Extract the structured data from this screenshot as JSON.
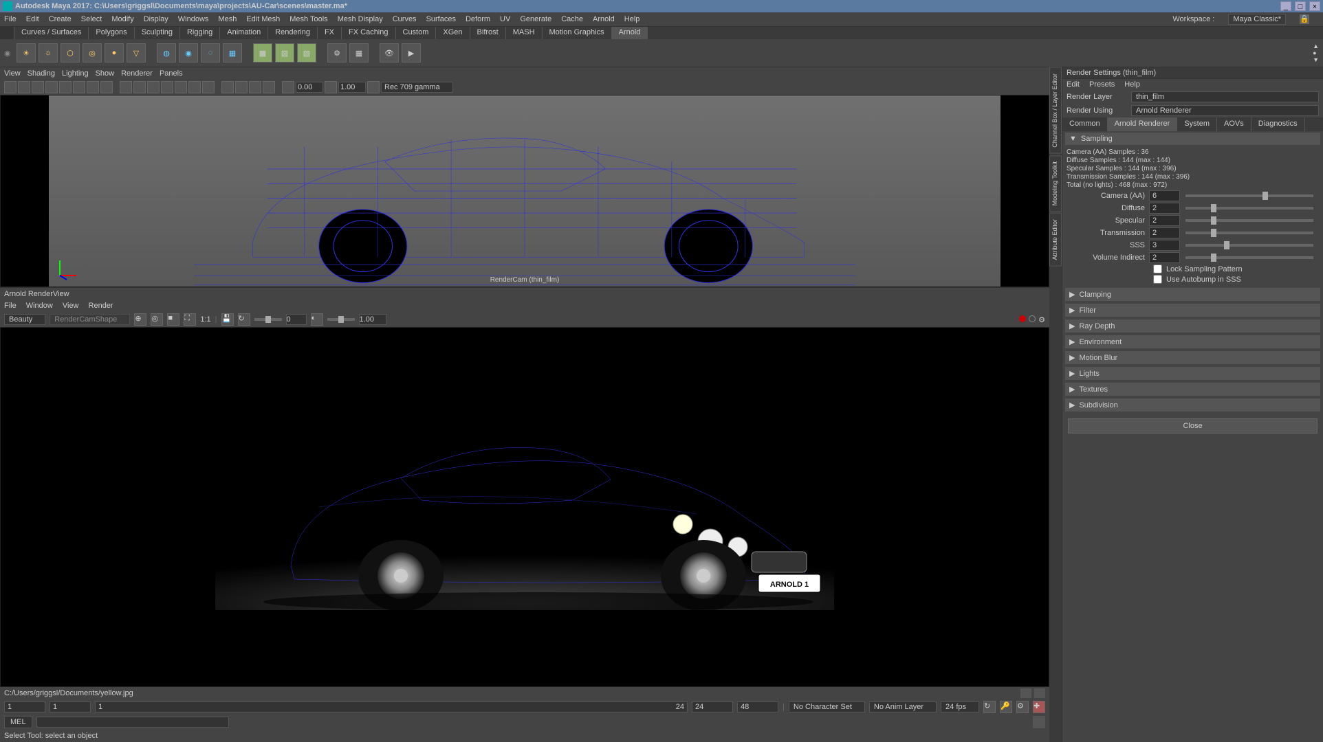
{
  "title": "Autodesk Maya 2017: C:\\Users\\griggsl\\Documents\\maya\\projects\\AU-Car\\scenes\\master.ma*",
  "menus": [
    "File",
    "Edit",
    "Create",
    "Select",
    "Modify",
    "Display",
    "Windows",
    "Mesh",
    "Edit Mesh",
    "Mesh Tools",
    "Mesh Display",
    "Curves",
    "Surfaces",
    "Deform",
    "UV",
    "Generate",
    "Cache",
    "Arnold",
    "Help"
  ],
  "workspace": {
    "label": "Workspace :",
    "value": "Maya Classic*"
  },
  "shelf_tabs": [
    "Curves / Surfaces",
    "Polygons",
    "Sculpting",
    "Rigging",
    "Animation",
    "Rendering",
    "FX",
    "FX Caching",
    "Custom",
    "XGen",
    "Bifrost",
    "MASH",
    "Motion Graphics",
    "Arnold"
  ],
  "shelf_active": "Arnold",
  "viewport_menus": [
    "View",
    "Shading",
    "Lighting",
    "Show",
    "Renderer",
    "Panels"
  ],
  "viewport_fields": {
    "a": "0.00",
    "b": "1.00",
    "gamma": "Rec 709 gamma"
  },
  "viewport_cam": "RenderCam (thin_film)",
  "side_tabs": [
    "Channel Box / Layer Editor",
    "Modeling Toolkit",
    "Attribute Editor"
  ],
  "renderview": {
    "title": "Arnold RenderView",
    "menus": [
      "File",
      "Window",
      "View",
      "Render"
    ],
    "layer_sel": "Beauty",
    "cam_sel": "RenderCamShape",
    "exp": "0",
    "gamma": "1.00",
    "plate": "ARNOLD 1",
    "path": "C:/Users/griggsl/Documents/yellow.jpg"
  },
  "timeline": {
    "start": "1",
    "start2": "1",
    "cur": "1",
    "end": "24",
    "range_end": "24",
    "range_end2": "48",
    "charset": "No Character Set",
    "animlayer": "No Anim Layer",
    "fps": "24 fps"
  },
  "cmd": {
    "lang": "MEL"
  },
  "status": "Select Tool: select an object",
  "rs": {
    "title": "Render Settings (thin_film)",
    "menus": [
      "Edit",
      "Presets",
      "Help"
    ],
    "layer_label": "Render Layer",
    "layer": "thin_film",
    "using_label": "Render Using",
    "using": "Arnold Renderer",
    "tabs": [
      "Common",
      "Arnold Renderer",
      "System",
      "AOVs",
      "Diagnostics"
    ],
    "tab_active": "Arnold Renderer",
    "sampling_title": "Sampling",
    "stats": [
      "Camera (AA) Samples : 36",
      "Diffuse Samples : 144 (max : 144)",
      "Specular Samples : 144 (max : 396)",
      "Transmission Samples : 144 (max : 396)",
      "Total (no lights) : 468 (max : 972)"
    ],
    "params": [
      {
        "label": "Camera (AA)",
        "value": "6",
        "pos": 60
      },
      {
        "label": "Diffuse",
        "value": "2",
        "pos": 20
      },
      {
        "label": "Specular",
        "value": "2",
        "pos": 20
      },
      {
        "label": "Transmission",
        "value": "2",
        "pos": 20
      },
      {
        "label": "SSS",
        "value": "3",
        "pos": 30
      },
      {
        "label": "Volume Indirect",
        "value": "2",
        "pos": 20
      }
    ],
    "checks": [
      "Lock Sampling Pattern",
      "Use Autobump in SSS"
    ],
    "sections": [
      "Clamping",
      "Filter",
      "Ray Depth",
      "Environment",
      "Motion Blur",
      "Lights",
      "Textures",
      "Subdivision"
    ],
    "close": "Close"
  }
}
